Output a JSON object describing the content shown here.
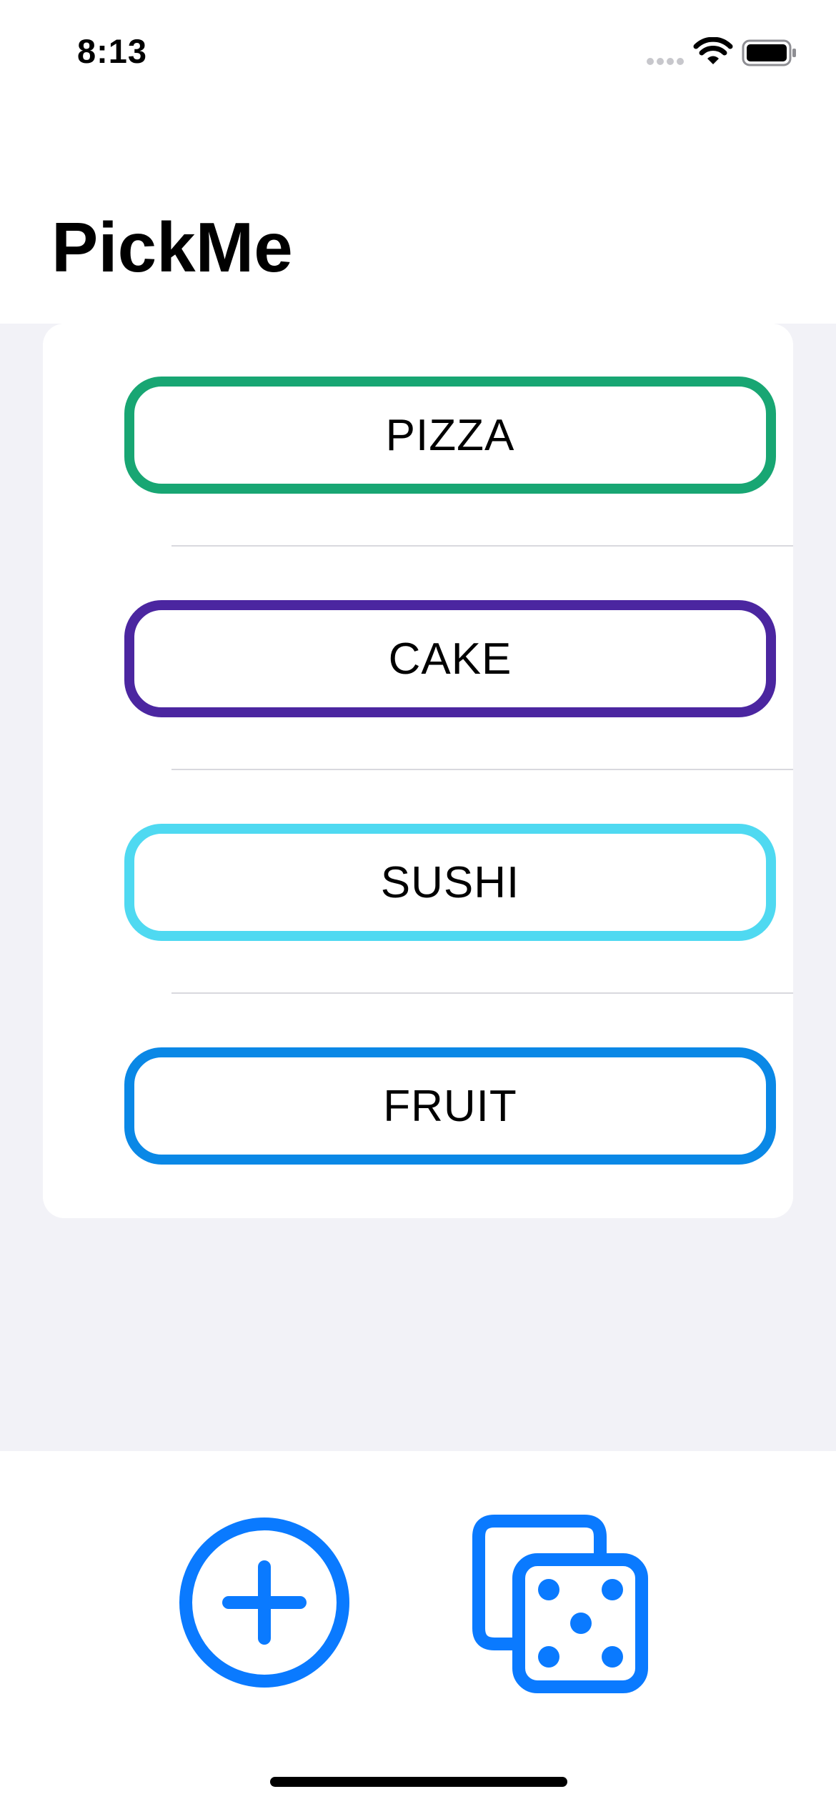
{
  "status_bar": {
    "time": "8:13",
    "icons": [
      "cellular-signal-icon",
      "wifi-icon",
      "battery-icon"
    ]
  },
  "header": {
    "title": "PickMe"
  },
  "options": [
    {
      "label": "PIZZA",
      "color": "#18a673"
    },
    {
      "label": "CAKE",
      "color": "#4b26a0"
    },
    {
      "label": "SUSHI",
      "color": "#4fd9f1"
    },
    {
      "label": "FRUIT",
      "color": "#0a88e6"
    }
  ],
  "toolbar": {
    "add_icon": "plus-circle-icon",
    "random_icon": "dice-icon",
    "accent_color": "#0a7aff"
  },
  "colors": {
    "background": "#f2f2f7",
    "card": "#ffffff",
    "separator": "#d9d9de"
  }
}
